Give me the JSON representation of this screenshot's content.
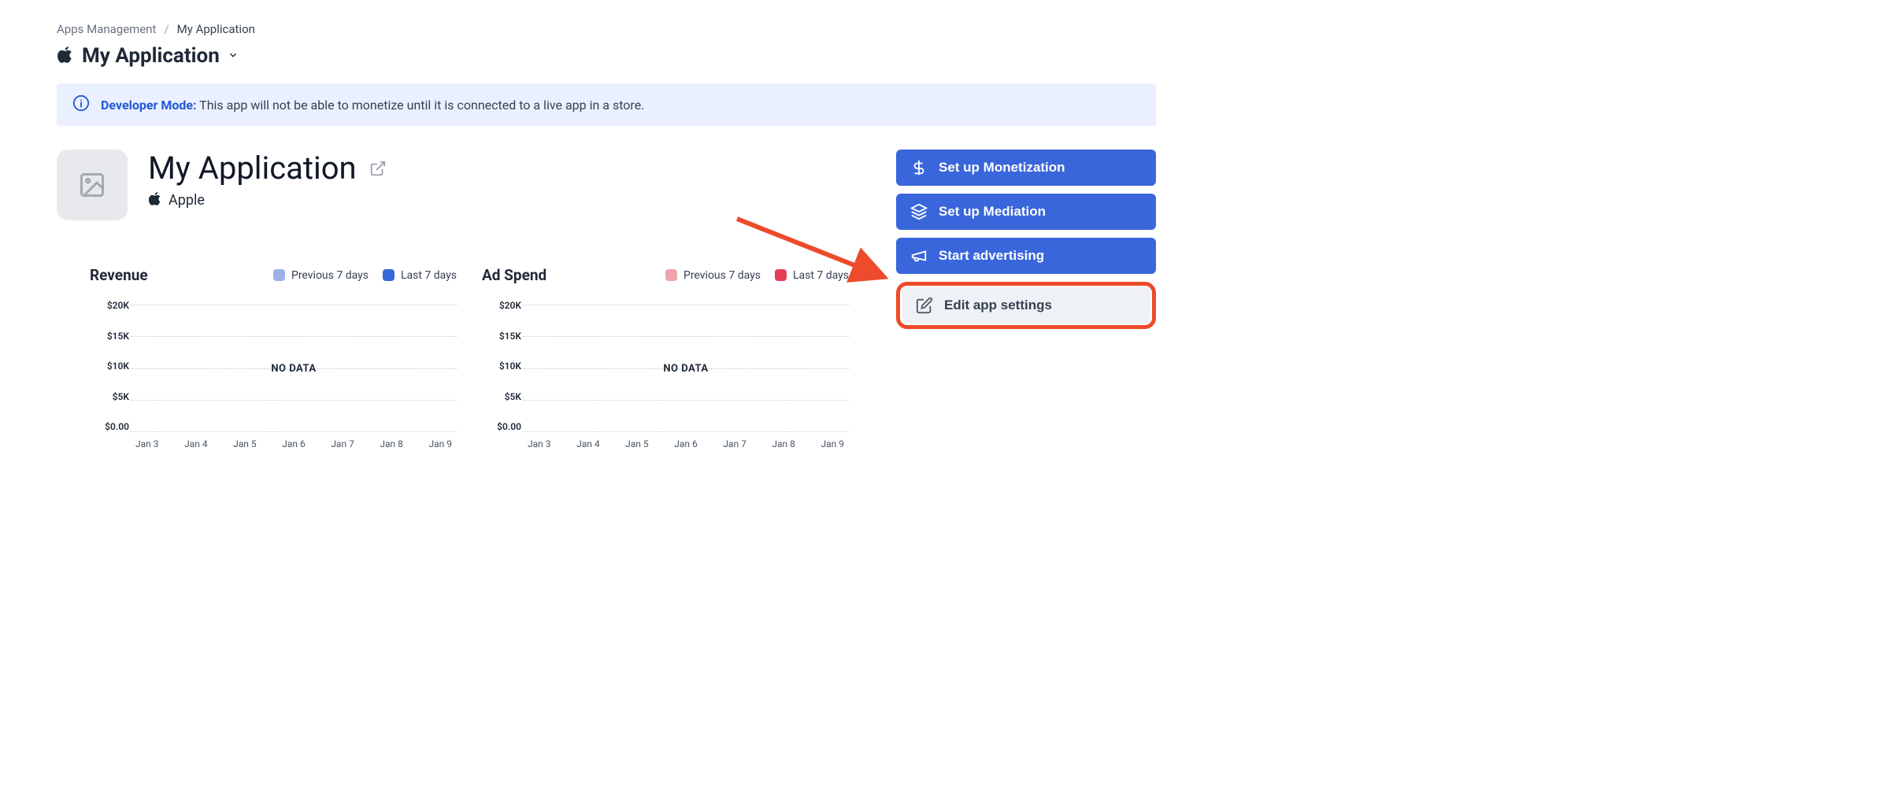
{
  "breadcrumb": {
    "root": "Apps Management",
    "current": "My Application"
  },
  "title": "My Application",
  "banner": {
    "prefix": "Developer Mode:",
    "text": "This app will not be able to monetize until it is connected to a live app in a store."
  },
  "app": {
    "name": "My Application",
    "platform": "Apple"
  },
  "actions": {
    "monetization": "Set up Monetization",
    "mediation": "Set up Mediation",
    "advertising": "Start advertising",
    "edit_settings": "Edit app settings"
  },
  "chart_data": [
    {
      "type": "line",
      "title": "Revenue",
      "categories": [
        "Jan 3",
        "Jan 4",
        "Jan 5",
        "Jan 6",
        "Jan 7",
        "Jan 8",
        "Jan 9"
      ],
      "series": [
        {
          "name": "Previous 7 days",
          "color": "#9cb0e8",
          "values": []
        },
        {
          "name": "Last 7 days",
          "color": "#3a66db",
          "values": []
        }
      ],
      "ylabels": [
        "$20K",
        "$15K",
        "$10K",
        "$5K",
        "$0.00"
      ],
      "no_data_label": "NO DATA"
    },
    {
      "type": "line",
      "title": "Ad Spend",
      "categories": [
        "Jan 3",
        "Jan 4",
        "Jan 5",
        "Jan 6",
        "Jan 7",
        "Jan 8",
        "Jan 9"
      ],
      "series": [
        {
          "name": "Previous 7 days",
          "color": "#eca5ab",
          "values": []
        },
        {
          "name": "Last 7 days",
          "color": "#e23e57",
          "values": []
        }
      ],
      "ylabels": [
        "$20K",
        "$15K",
        "$10K",
        "$5K",
        "$0.00"
      ],
      "no_data_label": "NO DATA"
    }
  ]
}
